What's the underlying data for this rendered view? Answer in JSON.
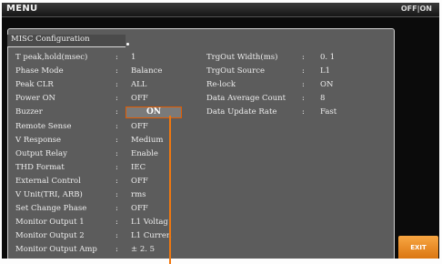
{
  "window": {
    "title": "MENU",
    "status": "OFF|ON"
  },
  "panel": {
    "title": "MISC Configuration"
  },
  "left_settings": [
    {
      "label": "T peak,hold(msec)",
      "value": "1"
    },
    {
      "label": "Phase Mode",
      "value": "Balance"
    },
    {
      "label": "Peak CLR",
      "value": "ALL"
    },
    {
      "label": "Power ON",
      "value": "OFF"
    },
    {
      "label": "Buzzer",
      "value": "ON"
    },
    {
      "label": "Remote Sense",
      "value": "OFF"
    },
    {
      "label": "V Response",
      "value": "Medium"
    },
    {
      "label": "Output Relay",
      "value": "Enable"
    },
    {
      "label": "THD Format",
      "value": "IEC"
    },
    {
      "label": "External Control",
      "value": "OFF"
    },
    {
      "label": "V Unit(TRI, ARB)",
      "value": "rms"
    },
    {
      "label": "Set Change Phase",
      "value": "OFF"
    },
    {
      "label": "Monitor Output 1",
      "value": "L1 Voltag"
    },
    {
      "label": "Monitor Output 2",
      "value": "L1 Curren"
    },
    {
      "label": "Monitor Output Amp",
      "value": "± 2. 5"
    }
  ],
  "right_settings": [
    {
      "label": "TrgOut Width(ms)",
      "value": "0. 1"
    },
    {
      "label": "TrgOut Source",
      "value": "L1"
    },
    {
      "label": "Re-lock",
      "value": "ON"
    },
    {
      "label": "Data Average Count",
      "value": "8"
    },
    {
      "label": "Data Update Rate",
      "value": "Fast"
    }
  ],
  "separator": ":",
  "selected": {
    "label": "Buzzer",
    "value": "ON"
  },
  "softkeys": {
    "exit": "EXIT"
  },
  "colors": {
    "highlight_border": "#e35c00",
    "callout": "#f07810",
    "exit_button": "#f39a30"
  }
}
